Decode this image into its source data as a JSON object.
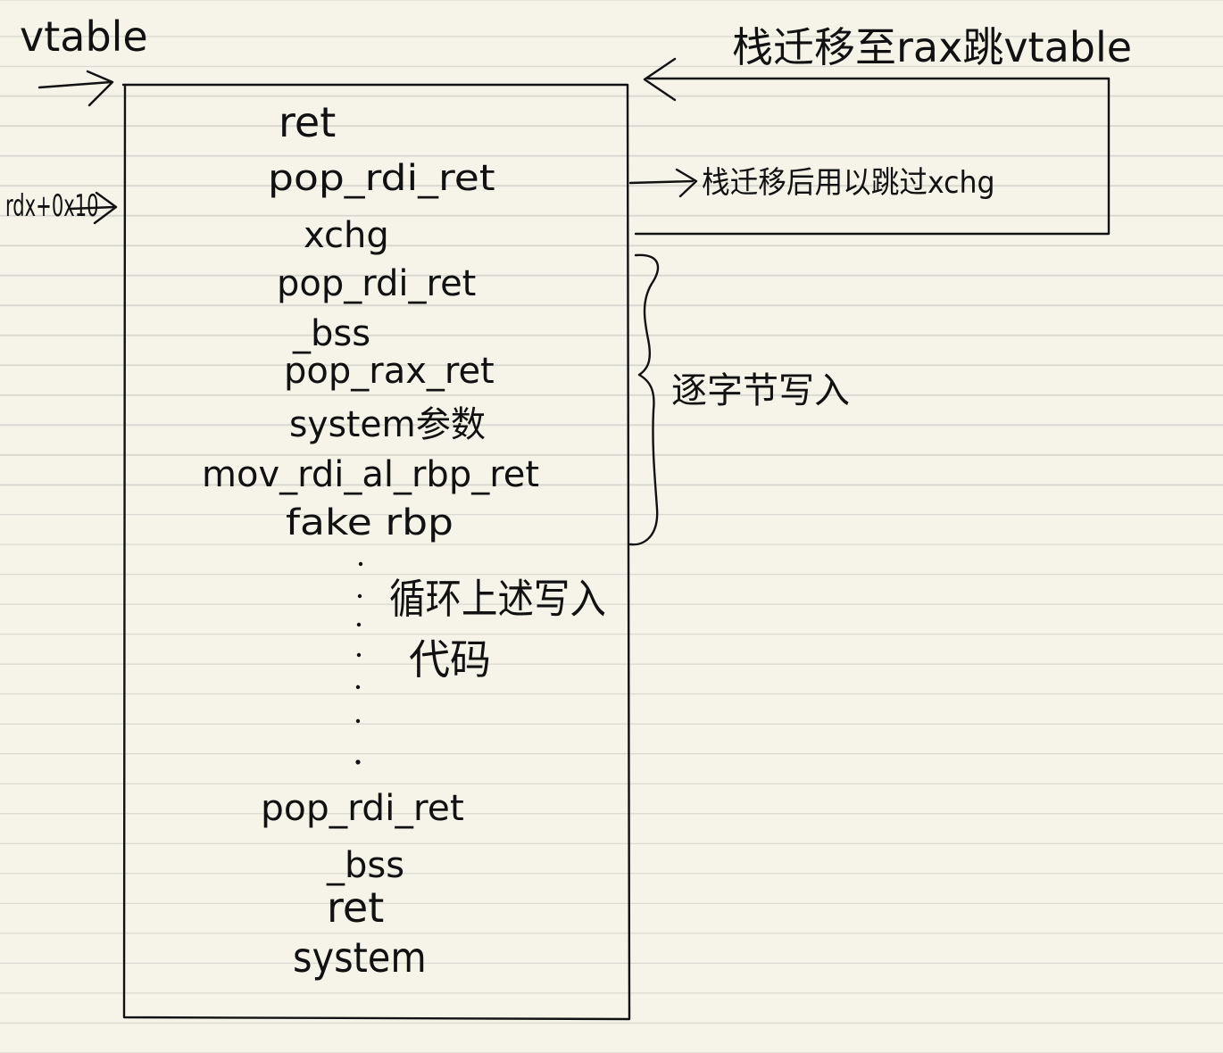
{
  "labels": {
    "vtable": "vtable",
    "rdx_pointer": "rdx+0x10",
    "pivot_note": "栈迁移至rax跳vtable",
    "skip_note": "栈迁移后用以跳过xchg",
    "brace_note": "逐字节写入",
    "loop_note_1": "循环上述写入",
    "loop_note_2": "代码"
  },
  "stack": {
    "top": [
      "ret",
      "pop_rdi_ret",
      "xchg",
      "pop_rdi_ret",
      "_bss",
      "pop_rax_ret",
      "system参数",
      "mov_rdi_al_rbp_ret",
      "fake rbp"
    ],
    "bottom": [
      "pop_rdi_ret",
      "_bss",
      "ret",
      "system"
    ]
  }
}
